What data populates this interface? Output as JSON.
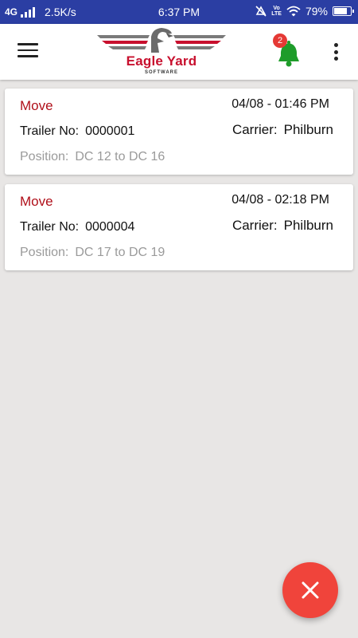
{
  "status_bar": {
    "network": "4G",
    "speed": "2.5K/s",
    "time": "6:37 PM",
    "volte_line1": "Vo",
    "volte_line2": "LTE",
    "battery": "79%",
    "battery_level": 0.79
  },
  "app_bar": {
    "logo_title": "Eagle Yard",
    "logo_subtitle": "SOFTWARE",
    "notification_count": "2",
    "bell_color": "#1e9c2a"
  },
  "cards": [
    {
      "type": "Move",
      "datetime": "04/08 - 01:46 PM",
      "trailer_label": "Trailer No:",
      "trailer_no": "0000001",
      "carrier_label": "Carrier:",
      "carrier": "Philburn",
      "position_label": "Position:",
      "position": "DC 12 to DC 16"
    },
    {
      "type": "Move",
      "datetime": "04/08 - 02:18 PM",
      "trailer_label": "Trailer No:",
      "trailer_no": "0000004",
      "carrier_label": "Carrier:",
      "carrier": "Philburn",
      "position_label": "Position:",
      "position": "DC 17 to DC 19"
    }
  ],
  "fab": {
    "icon": "close-icon",
    "color": "#f0443b"
  },
  "colors": {
    "status_bar": "#2b3ea3",
    "accent_red": "#b0101a",
    "background": "#e8e6e5"
  }
}
